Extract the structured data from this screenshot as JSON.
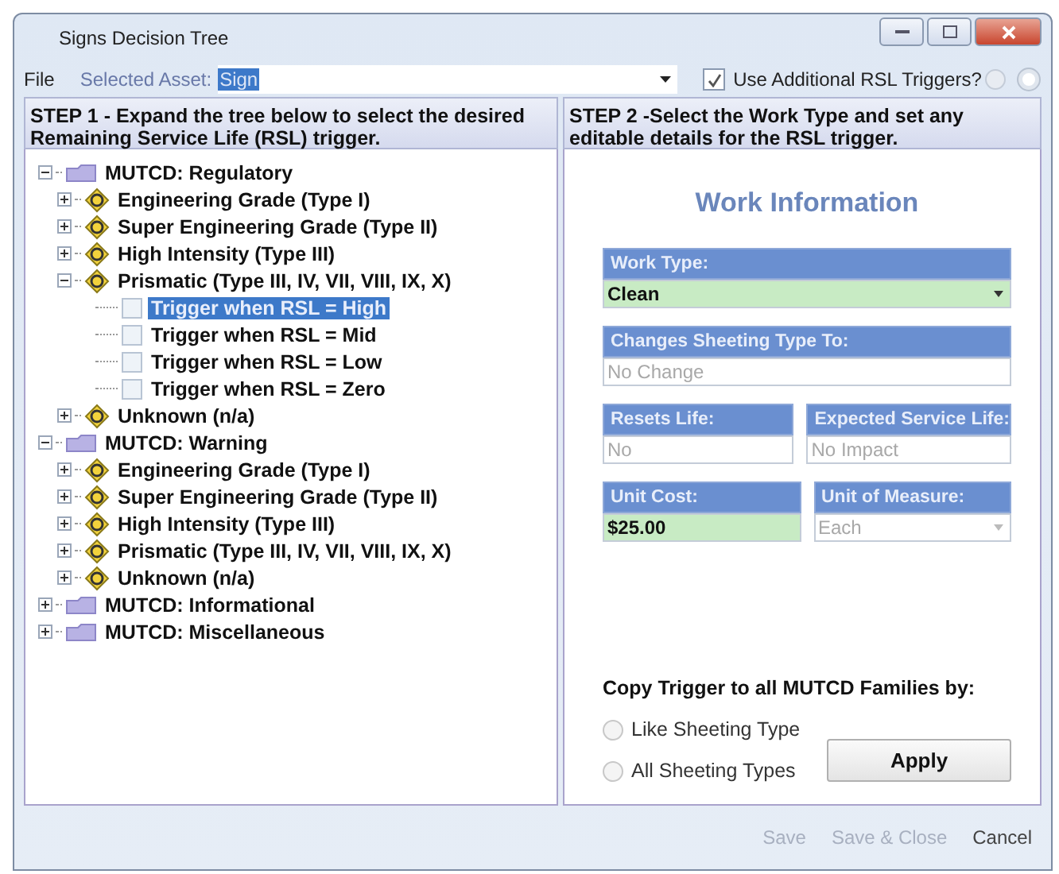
{
  "window": {
    "title": "Signs Decision Tree"
  },
  "toolbar": {
    "menu": "File",
    "asset_label": "Selected Asset:",
    "asset_value": "Sign",
    "asset_value_selected": true,
    "triggers_checkbox": {
      "label": "Use Additional RSL Triggers?",
      "checked": true
    }
  },
  "step1": {
    "heading": "STEP 1 - Expand the tree below to select the desired Remaining Service Life (RSL) trigger."
  },
  "step2": {
    "heading": "STEP 2 -Select the Work Type and set any editable details for the RSL trigger."
  },
  "tree": [
    {
      "label": "MUTCD: Regulatory",
      "kind": "folder",
      "expanded": true,
      "children": [
        {
          "label": "Engineering Grade (Type I)",
          "kind": "sheeting",
          "expanded": false
        },
        {
          "label": "Super Engineering Grade (Type II)",
          "kind": "sheeting",
          "expanded": false
        },
        {
          "label": "High Intensity (Type III)",
          "kind": "sheeting",
          "expanded": false
        },
        {
          "label": "Prismatic (Type III, IV, VII, VIII, IX, X)",
          "kind": "sheeting",
          "expanded": true,
          "children": [
            {
              "label": "Trigger when RSL = High",
              "kind": "trigger",
              "selected": true
            },
            {
              "label": "Trigger when RSL = Mid",
              "kind": "trigger",
              "selected": false
            },
            {
              "label": "Trigger when RSL = Low",
              "kind": "trigger",
              "selected": false
            },
            {
              "label": "Trigger when RSL = Zero",
              "kind": "trigger",
              "selected": false
            }
          ]
        },
        {
          "label": "Unknown (n/a)",
          "kind": "sheeting",
          "expanded": false
        }
      ]
    },
    {
      "label": "MUTCD: Warning",
      "kind": "folder",
      "expanded": true,
      "children": [
        {
          "label": "Engineering Grade (Type I)",
          "kind": "sheeting",
          "expanded": false
        },
        {
          "label": "Super Engineering Grade (Type II)",
          "kind": "sheeting",
          "expanded": false
        },
        {
          "label": "High Intensity (Type III)",
          "kind": "sheeting",
          "expanded": false
        },
        {
          "label": "Prismatic (Type III, IV, VII, VIII, IX, X)",
          "kind": "sheeting",
          "expanded": false
        },
        {
          "label": "Unknown (n/a)",
          "kind": "sheeting",
          "expanded": false
        }
      ]
    },
    {
      "label": "MUTCD: Informational",
      "kind": "folder",
      "expanded": false
    },
    {
      "label": "MUTCD: Miscellaneous",
      "kind": "folder",
      "expanded": false
    }
  ],
  "work_info": {
    "title": "Work Information",
    "rows": [
      [
        {
          "label": "Work Type:",
          "value": "Clean",
          "editable": true,
          "dropdown": true
        }
      ],
      [
        {
          "label": "Changes Sheeting Type To:",
          "value": "No Change",
          "editable": false
        }
      ],
      [
        {
          "label": "Resets Life:",
          "value": "No",
          "editable": false
        },
        {
          "label": "Expected Service Life:",
          "value": "No Impact",
          "editable": false
        }
      ],
      [
        {
          "label": "Unit Cost:",
          "value": "$25.00",
          "editable": true
        },
        {
          "label": "Unit of Measure:",
          "value": "Each",
          "editable": false,
          "dropdown": true
        }
      ]
    ]
  },
  "copy": {
    "title": "Copy Trigger to all MUTCD Families by:",
    "options": [
      {
        "label": "Like Sheeting Type",
        "selected": false
      },
      {
        "label": "All Sheeting Types",
        "selected": false
      }
    ],
    "apply": "Apply"
  },
  "footer": [
    {
      "label": "Save",
      "disabled": true
    },
    {
      "label": "Save & Close",
      "disabled": true
    },
    {
      "label": "Cancel",
      "disabled": false
    }
  ]
}
